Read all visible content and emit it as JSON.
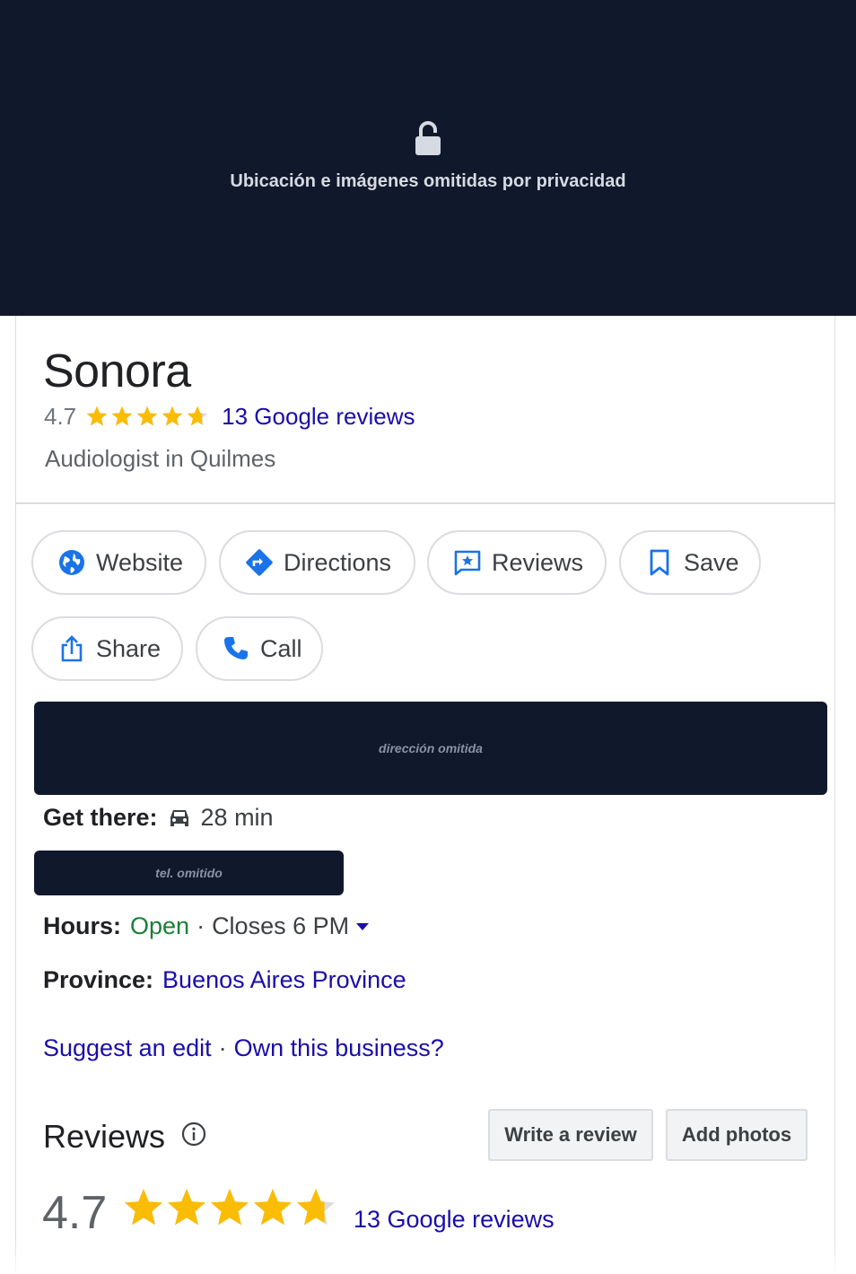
{
  "privacy_banner": {
    "text": "Ubicación e imágenes omitidas por privacidad"
  },
  "business": {
    "name": "Sonora",
    "rating": "4.7",
    "rating_value": 4.7,
    "reviews_link": "13 Google reviews",
    "category": "Audiologist in Quilmes"
  },
  "actions": {
    "website": "Website",
    "directions": "Directions",
    "reviews": "Reviews",
    "save": "Save",
    "share": "Share",
    "call": "Call"
  },
  "redactions": {
    "address": "dirección omitida",
    "phone": "tel. omitido"
  },
  "get_there": {
    "label": "Get there:",
    "value": "28 min"
  },
  "hours": {
    "label": "Hours:",
    "status": "Open",
    "separator": "·",
    "closes": "Closes 6 PM"
  },
  "province": {
    "label": "Province:",
    "value": "Buenos Aires Province"
  },
  "links": {
    "suggest_edit": "Suggest an edit",
    "separator": "·",
    "own_business": "Own this business?"
  },
  "reviews_section": {
    "heading": "Reviews",
    "write_review": "Write a review",
    "add_photos": "Add photos",
    "rating": "4.7",
    "rating_value": 4.7,
    "reviews_link": "13 Google reviews"
  },
  "colors": {
    "banner_bg": "#10182b",
    "star": "#fbbc04",
    "star_empty": "#dadce0",
    "link": "#1a0dab",
    "open": "#188038",
    "icon_blue": "#1a73e8"
  }
}
